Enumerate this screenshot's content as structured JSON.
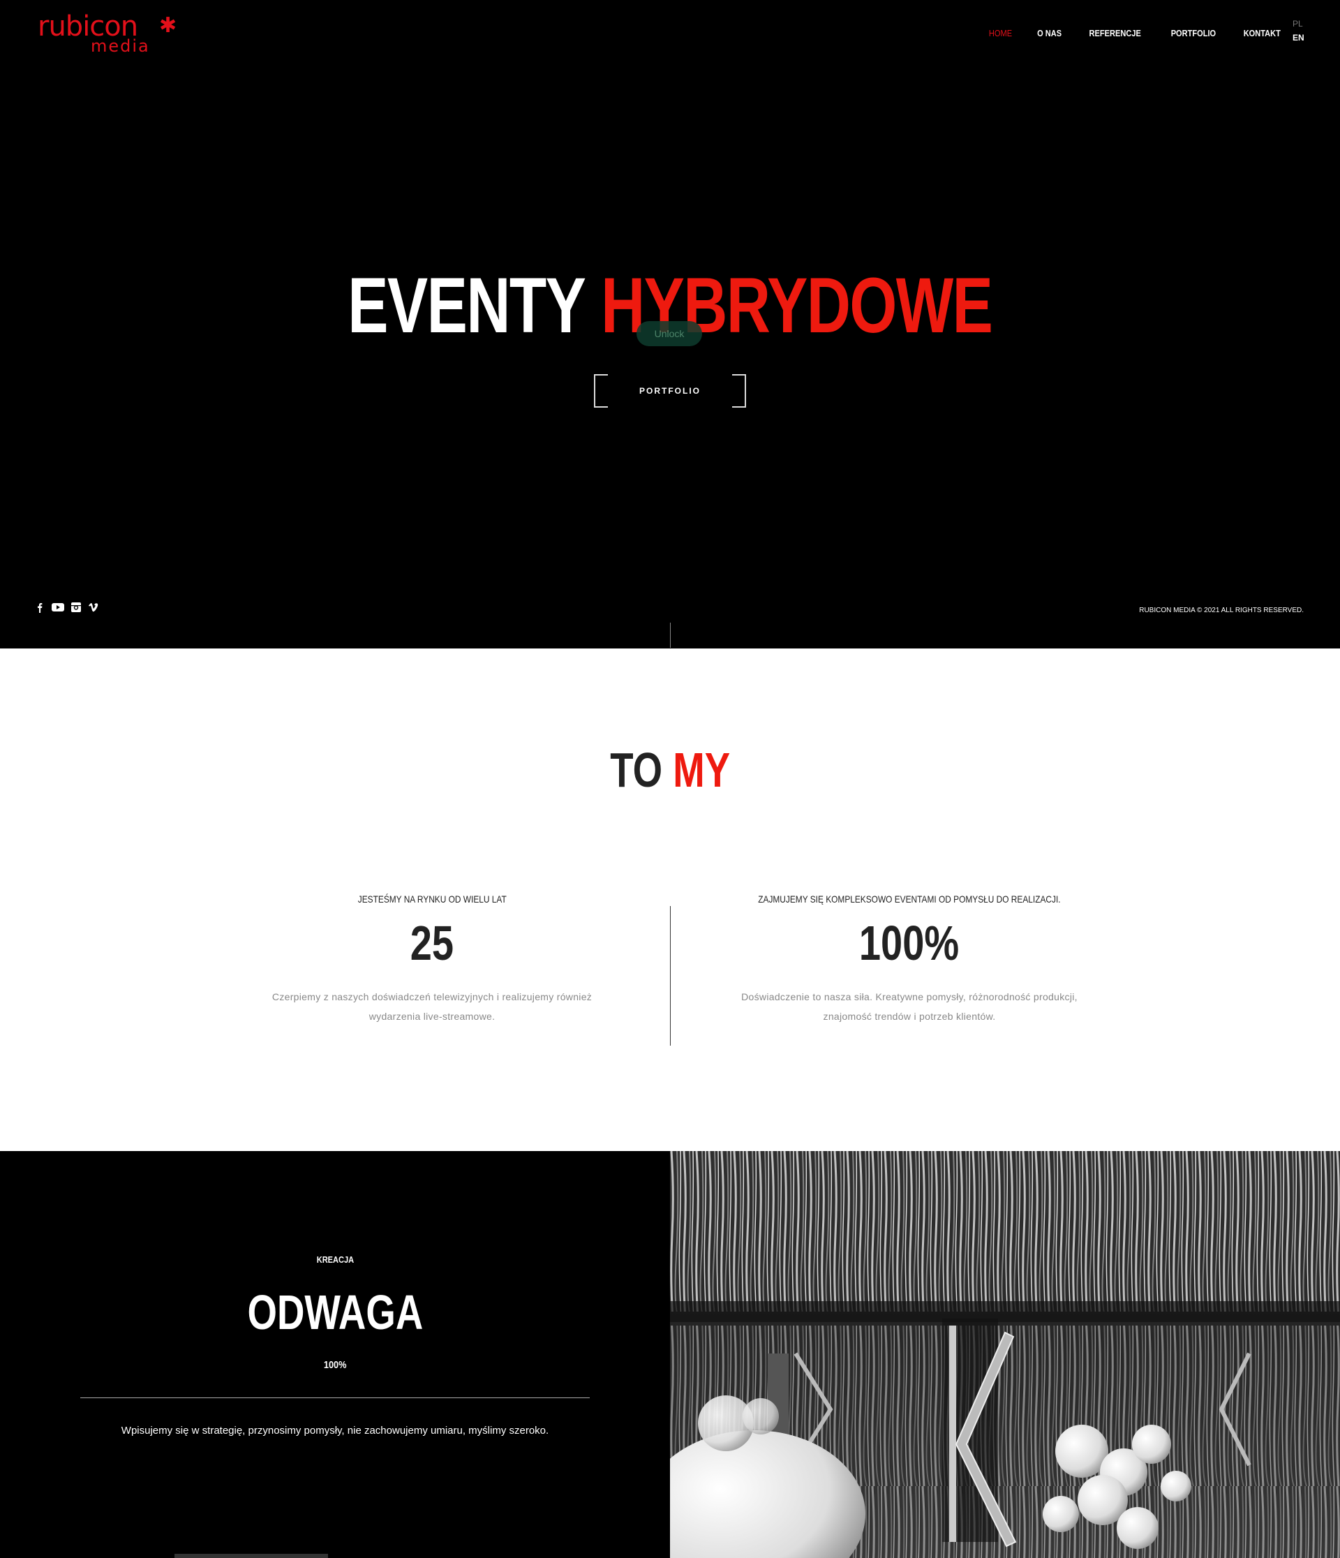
{
  "brand": {
    "name": "rubicon",
    "sub": "media",
    "mark": "✱",
    "accent": "#e3101a"
  },
  "nav": {
    "items": [
      {
        "label": "HOME",
        "active": true
      },
      {
        "label": "O NAS",
        "active": false
      },
      {
        "label": "REFERENCJE",
        "active": false
      },
      {
        "label": "PORTFOLIO",
        "active": false
      },
      {
        "label": "KONTAKT",
        "active": false
      }
    ],
    "lang": {
      "pl": "PL",
      "en": "EN"
    }
  },
  "hero": {
    "title_white": "EVENTY",
    "title_red": "HYBRYDOWE",
    "ghost_label": "Unlock",
    "button": "PORTFOLIO",
    "socials": [
      "facebook-icon",
      "youtube-icon",
      "instagram-icon",
      "vimeo-icon"
    ],
    "copyright": "RUBICON MEDIA © 2021 ALL RIGHTS RESERVED."
  },
  "about": {
    "title_dark": "TO",
    "title_red": "MY",
    "stats": [
      {
        "caption": "JESTEŚMY NA RYNKU OD WIELU LAT",
        "value": "25",
        "desc": "Czerpiemy z naszych doświadczeń telewizyjnych i realizujemy również wydarzenia live-streamowe."
      },
      {
        "caption": "ZAJMUJEMY SIĘ KOMPLEKSOWO EVENTAMI OD POMYSŁU DO REALIZACJI.",
        "value": "100%",
        "desc": "Doświadczenie to nasza siła. Kreatywne pomysły, różnorodność produkcji, znajomość trendów i potrzeb klientów."
      }
    ]
  },
  "kreacja": {
    "label": "KREACJA",
    "title": "ODWAGA",
    "percent": "100%",
    "text": "Wpisujemy się w strategię, przynosimy pomysły, nie zachowujemy umiaru, myślimy szeroko."
  }
}
